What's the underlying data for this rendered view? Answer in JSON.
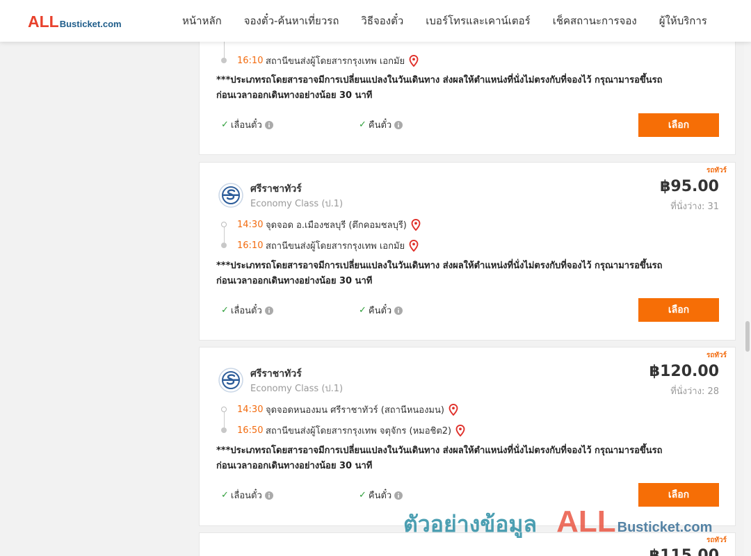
{
  "header": {
    "logo_all": "ALL",
    "logo_rest": "Busticket.com",
    "nav": [
      "หน้าหลัก",
      "จองตั๋ว-ค้นหาเที่ยวรถ",
      "วิธีจองตั๋ว",
      "เบอร์โทรและเคาน์เตอร์",
      "เช็คสถานะการจอง",
      "ผู้ให้บริการ"
    ]
  },
  "common": {
    "notice_line1": "***ประเภทรถโดยสารอาจมีการเปลี่ยนแปลงในวันเดินทาง ส่งผลให้ตำแหน่งที่นั่งไม่ตรงกับที่จองไว้ กรุณามารอขึ้นรถ",
    "notice_line2": "ก่อนเวลาออกเดินทางอย่างน้อย 30 นาที",
    "change_ticket": "เลื่อนตั๋ว",
    "refund_ticket": "คืนตั๋ว",
    "select_label": "เลือก",
    "badge": "รถทัวร์",
    "seats_prefix": "ที่นั่งว่าง: "
  },
  "cards": [
    {
      "arrive_time": "16:10",
      "arrive_place": "สถานีขนส่งผู้โดยสารกรุงเทพ เอกมัย"
    },
    {
      "operator": "ศรีราชาทัวร์",
      "class": "Economy Class (ป.1)",
      "price": "฿95.00",
      "seats": "ที่นั่งว่าง: 31",
      "depart_time": "14:30",
      "depart_place": "จุดจอด อ.เมืองชลบุรี (ตึกคอมชลบุรี)",
      "arrive_time": "16:10",
      "arrive_place": "สถานีขนส่งผู้โดยสารกรุงเทพ เอกมัย"
    },
    {
      "operator": "ศรีราชาทัวร์",
      "class": "Economy Class (ป.1)",
      "price": "฿120.00",
      "seats": "ที่นั่งว่าง: 28",
      "depart_time": "14:30",
      "depart_place": "จุดจอดหนองมน ศรีราชาทัวร์ (สถานีหนองมน)",
      "arrive_time": "16:50",
      "arrive_place": "สถานีขนส่งผู้โดยสารกรุงเทพ จตุจักร (หมอชิต2)"
    },
    {
      "price": "฿115.00"
    }
  ],
  "watermark": {
    "thai": "ตัวอย่างข้อมูล",
    "all": "ALL",
    "rest": "Busticket.com"
  },
  "colors": {
    "accent": "#f66e06",
    "time": "#f26b0f",
    "check": "#2e9e3a",
    "pin": "#e0302a",
    "logo_red": "#e8412c",
    "logo_blue": "#1f5d8a"
  }
}
